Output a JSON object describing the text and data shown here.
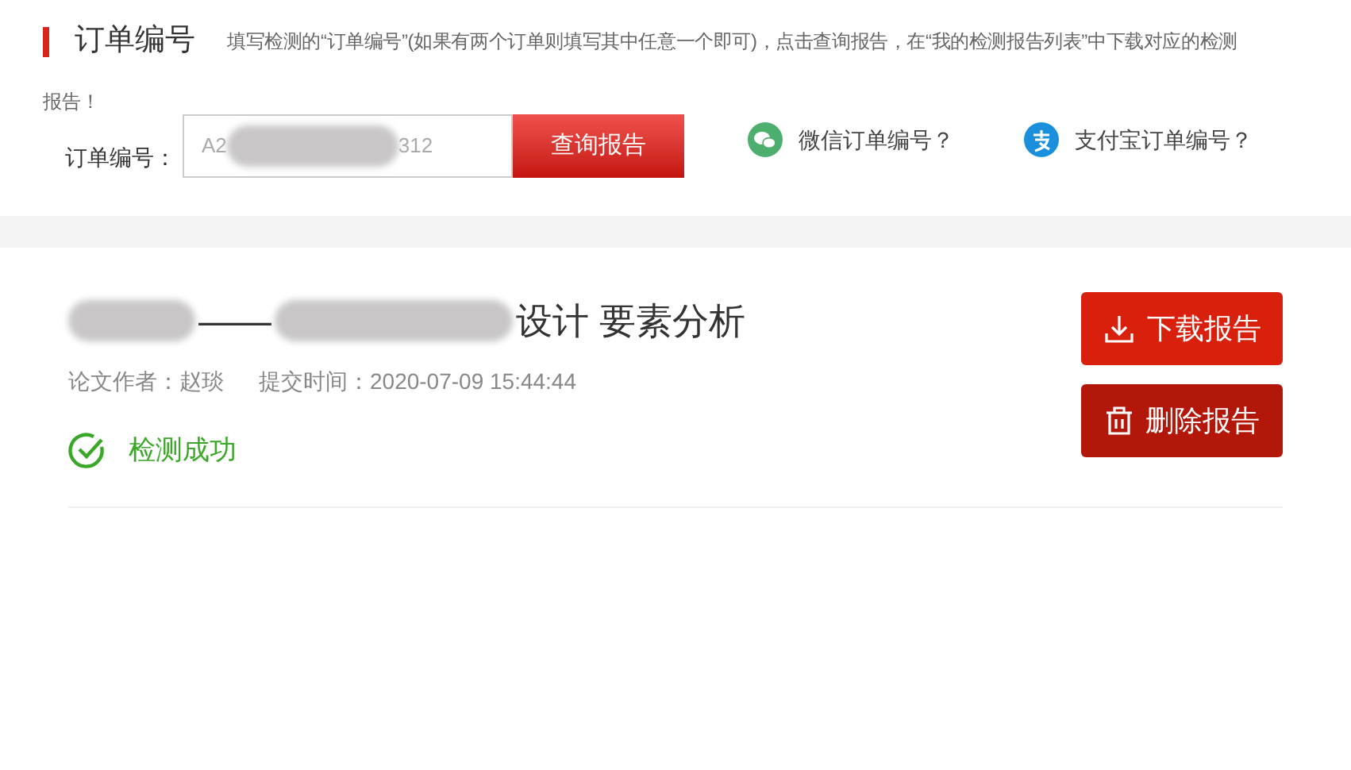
{
  "header": {
    "title": "订单编号",
    "instructions_lines": [
      "填写检测的“订单编号”(如果有两个订单则填写其中任意一个即可)，点击查询报告，在“我的检测报告列表”中下载对应的检测",
      "报告！"
    ]
  },
  "search": {
    "label": "订单编号：",
    "value_start": "A2",
    "value_end": "312",
    "button": "查询报告"
  },
  "help_links": [
    {
      "kind": "wechat",
      "label": "微信订单编号？"
    },
    {
      "kind": "alipay",
      "label": "支付宝订单编号？"
    }
  ],
  "report": {
    "title_parts": [
      "——",
      "设计 要素分析"
    ],
    "author": "论文作者：赵琰",
    "submitted": "提交时间：2020-07-09 15:44:44",
    "status": "检测成功",
    "actions": [
      {
        "kind": "download",
        "label": "下载报告"
      },
      {
        "kind": "delete",
        "label": "删除报告"
      }
    ]
  }
}
